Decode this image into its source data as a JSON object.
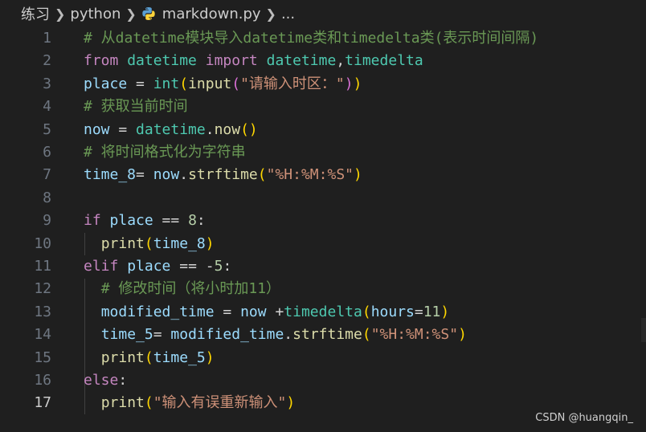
{
  "breadcrumb": {
    "folder": "练习",
    "subfolder": "python",
    "file": "markdown.py",
    "more": "..."
  },
  "colors": {
    "background": "#1f1f1f",
    "keyword": "#c586c0",
    "comment": "#6a9955",
    "function": "#dcdcaa",
    "variable": "#9cdcfe",
    "class": "#4ec9b0",
    "string": "#ce9178",
    "number": "#b5cea8"
  },
  "active_line": 17,
  "lines": [
    {
      "n": "1",
      "tokens": [
        [
          "cm",
          "# 从datetime模块导入datetime类和timedelta类(表示时间间隔)"
        ]
      ]
    },
    {
      "n": "2",
      "tokens": [
        [
          "kw",
          "from"
        ],
        [
          "op",
          " "
        ],
        [
          "cls",
          "datetime"
        ],
        [
          "op",
          " "
        ],
        [
          "kw",
          "import"
        ],
        [
          "op",
          " "
        ],
        [
          "cls",
          "datetime"
        ],
        [
          "op",
          ","
        ],
        [
          "cls",
          "timedelta"
        ]
      ]
    },
    {
      "n": "3",
      "tokens": [
        [
          "var",
          "place"
        ],
        [
          "op",
          " = "
        ],
        [
          "bi",
          "int"
        ],
        [
          "p1",
          "("
        ],
        [
          "fn",
          "input"
        ],
        [
          "p2",
          "("
        ],
        [
          "str",
          "\"请输入时区：\""
        ],
        [
          "p2",
          ")"
        ],
        [
          "p1",
          ")"
        ]
      ]
    },
    {
      "n": "4",
      "tokens": [
        [
          "cm",
          "# 获取当前时间"
        ]
      ]
    },
    {
      "n": "5",
      "tokens": [
        [
          "var",
          "now"
        ],
        [
          "op",
          " = "
        ],
        [
          "cls",
          "datetime"
        ],
        [
          "op",
          "."
        ],
        [
          "fn",
          "now"
        ],
        [
          "p1",
          "()"
        ]
      ]
    },
    {
      "n": "6",
      "tokens": [
        [
          "cm",
          "# 将时间格式化为字符串"
        ]
      ]
    },
    {
      "n": "7",
      "tokens": [
        [
          "var",
          "time_8"
        ],
        [
          "op",
          "= "
        ],
        [
          "var",
          "now"
        ],
        [
          "op",
          "."
        ],
        [
          "fn",
          "strftime"
        ],
        [
          "p1",
          "("
        ],
        [
          "str",
          "\"%H:%M:%S\""
        ],
        [
          "p1",
          ")"
        ]
      ]
    },
    {
      "n": "8",
      "tokens": []
    },
    {
      "n": "9",
      "tokens": [
        [
          "kw",
          "if"
        ],
        [
          "op",
          " "
        ],
        [
          "var",
          "place"
        ],
        [
          "op",
          " == "
        ],
        [
          "num",
          "8"
        ],
        [
          "op",
          ":"
        ]
      ]
    },
    {
      "n": "10",
      "tokens": [
        [
          "op",
          "  "
        ],
        [
          "fn",
          "print"
        ],
        [
          "p1",
          "("
        ],
        [
          "var",
          "time_8"
        ],
        [
          "p1",
          ")"
        ]
      ]
    },
    {
      "n": "11",
      "tokens": [
        [
          "kw",
          "elif"
        ],
        [
          "op",
          " "
        ],
        [
          "var",
          "place"
        ],
        [
          "op",
          " == "
        ],
        [
          "op",
          "-"
        ],
        [
          "num",
          "5"
        ],
        [
          "op",
          ":"
        ]
      ]
    },
    {
      "n": "12",
      "tokens": [
        [
          "op",
          "  "
        ],
        [
          "cm",
          "# 修改时间（将小时加11）"
        ]
      ]
    },
    {
      "n": "13",
      "tokens": [
        [
          "op",
          "  "
        ],
        [
          "var",
          "modified_time"
        ],
        [
          "op",
          " = "
        ],
        [
          "var",
          "now"
        ],
        [
          "op",
          " +"
        ],
        [
          "cls",
          "timedelta"
        ],
        [
          "p1",
          "("
        ],
        [
          "var",
          "hours"
        ],
        [
          "op",
          "="
        ],
        [
          "num",
          "11"
        ],
        [
          "p1",
          ")"
        ]
      ]
    },
    {
      "n": "14",
      "tokens": [
        [
          "op",
          "  "
        ],
        [
          "var",
          "time_5"
        ],
        [
          "op",
          "= "
        ],
        [
          "var",
          "modified_time"
        ],
        [
          "op",
          "."
        ],
        [
          "fn",
          "strftime"
        ],
        [
          "p1",
          "("
        ],
        [
          "str",
          "\"%H:%M:%S\""
        ],
        [
          "p1",
          ")"
        ]
      ]
    },
    {
      "n": "15",
      "tokens": [
        [
          "op",
          "  "
        ],
        [
          "fn",
          "print"
        ],
        [
          "p1",
          "("
        ],
        [
          "var",
          "time_5"
        ],
        [
          "p1",
          ")"
        ]
      ]
    },
    {
      "n": "16",
      "tokens": [
        [
          "kw",
          "else"
        ],
        [
          "op",
          ":"
        ]
      ]
    },
    {
      "n": "17",
      "tokens": [
        [
          "op",
          "  "
        ],
        [
          "fn",
          "print"
        ],
        [
          "p1",
          "("
        ],
        [
          "str",
          "\"输入有误重新输入\""
        ],
        [
          "p1",
          ")"
        ]
      ]
    }
  ],
  "watermark": "CSDN @huangqin_"
}
